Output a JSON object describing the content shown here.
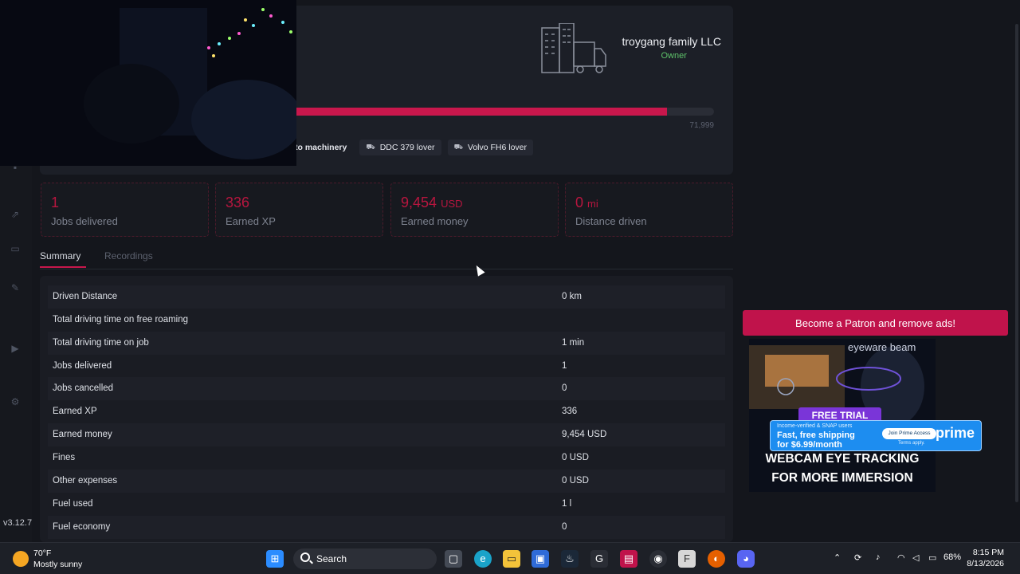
{
  "app": {
    "version": "v3.12.7"
  },
  "profile": {
    "company_name": "troygang family LLC",
    "company_role": "Owner",
    "xp_bar_max_label": "71,999",
    "xp_progress": 0.93,
    "badges": [
      {
        "label": "to machinery",
        "icon": "truck-icon"
      },
      {
        "label": "DDC 379 lover",
        "icon": "truck-icon"
      },
      {
        "label": "Volvo FH6 lover",
        "icon": "truck-icon"
      }
    ]
  },
  "stats": [
    {
      "value": "1",
      "unit": "",
      "label": "Jobs delivered"
    },
    {
      "value": "336",
      "unit": "",
      "label": "Earned XP"
    },
    {
      "value": "9,454",
      "unit": "USD",
      "label": "Earned money"
    },
    {
      "value": "0",
      "unit": "mi",
      "label": "Distance driven"
    }
  ],
  "tabs": [
    {
      "label": "Summary",
      "active": true
    },
    {
      "label": "Recordings",
      "active": false
    }
  ],
  "summary_rows": [
    {
      "key": "Driven Distance",
      "value": "0 km"
    },
    {
      "key": "Total driving time on free roaming",
      "value": ""
    },
    {
      "key": "Total driving time on job",
      "value": "1 min"
    },
    {
      "key": "Jobs delivered",
      "value": "1"
    },
    {
      "key": "Jobs cancelled",
      "value": "0"
    },
    {
      "key": "Earned XP",
      "value": "336"
    },
    {
      "key": "Earned money",
      "value": "9,454 USD"
    },
    {
      "key": "Fines",
      "value": "0 USD"
    },
    {
      "key": "Other expenses",
      "value": "0 USD"
    },
    {
      "key": "Fuel used",
      "value": "1 l"
    },
    {
      "key": "Fuel economy",
      "value": "0"
    }
  ],
  "ads": {
    "patron_button": "Become a Patron and remove ads!",
    "brand": "eyeware beam",
    "trial": "FREE TRIAL",
    "headline_1": "WEBCAM EYE TRACKING",
    "headline_2": "FOR MORE IMMERSION",
    "prime_top": "Income-verified & SNAP users",
    "prime_line1": "Fast, free shipping",
    "prime_line2": "for $6.99/month",
    "prime_join": "Join Prime Access",
    "prime_terms": "Terms apply.",
    "prime_logo": "prime"
  },
  "taskbar": {
    "temperature": "70°F",
    "condition": "Mostly sunny",
    "search_label": "Search",
    "battery": "68%",
    "time": "8:15 PM",
    "date": "8/13/2026"
  },
  "colors": {
    "accent": "#c8174c",
    "owner": "#5ec26a",
    "patron": "#c0134b"
  }
}
